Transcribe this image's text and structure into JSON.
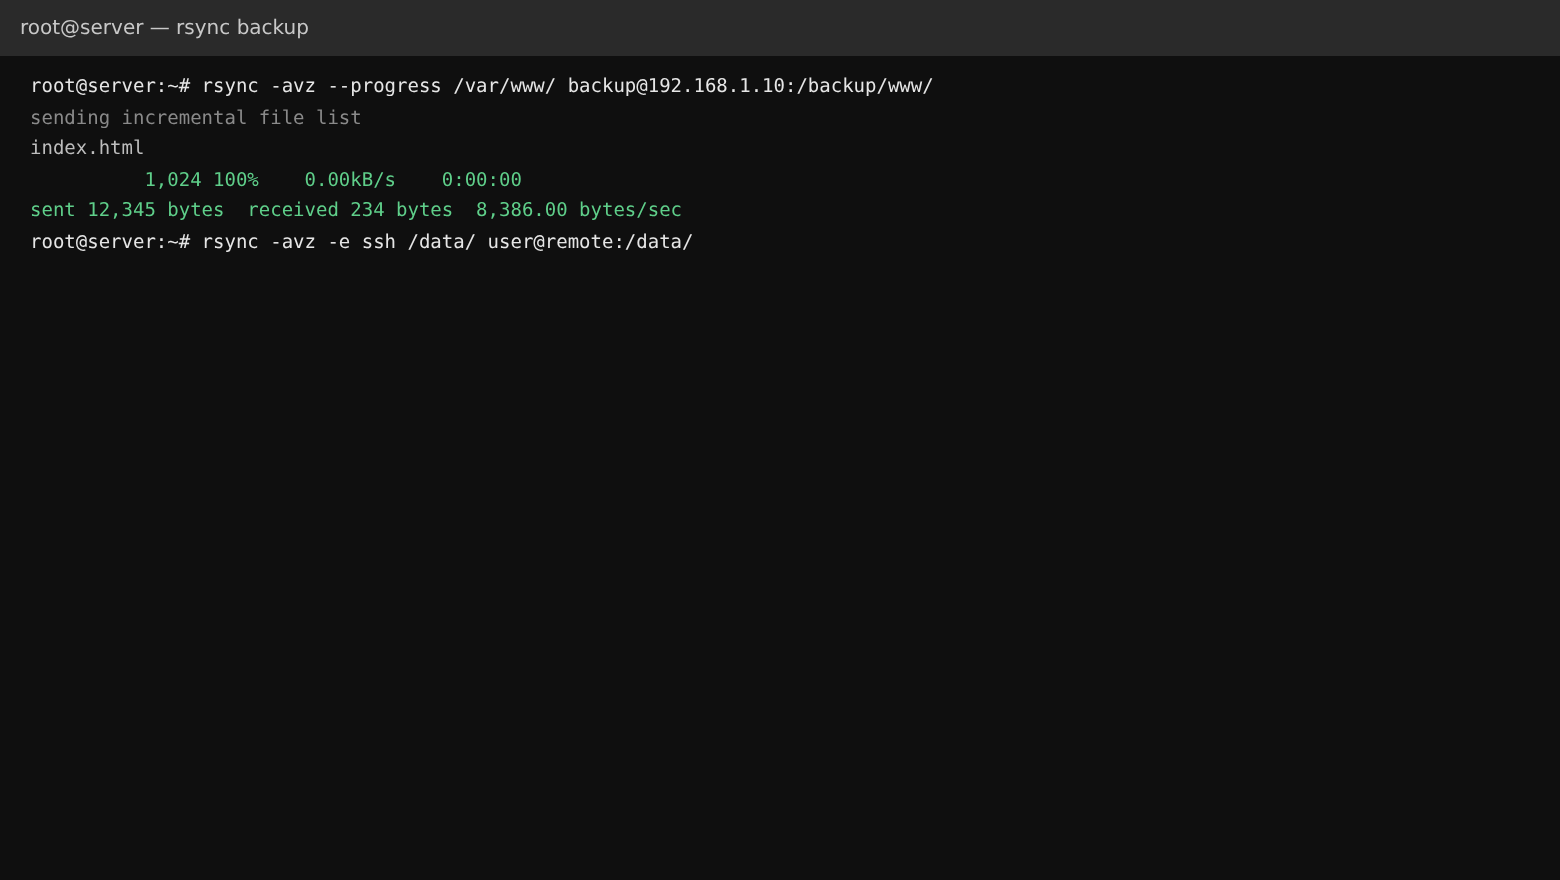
{
  "window": {
    "title": "root@server — rsync backup"
  },
  "terminal": {
    "lines": [
      {
        "kind": "command",
        "text": "root@server:~# rsync -avz --progress /var/www/ backup@192.168.1.10:/backup/www/"
      },
      {
        "kind": "info",
        "text": "sending incremental file list"
      },
      {
        "kind": "output",
        "text": "index.html"
      },
      {
        "kind": "success",
        "text": "          1,024 100%    0.00kB/s    0:00:00"
      },
      {
        "kind": "success",
        "text": "sent 12,345 bytes  received 234 bytes  8,386.00 bytes/sec"
      },
      {
        "kind": "command",
        "text": "root@server:~# rsync -avz -e ssh /data/ user@remote:/data/"
      }
    ]
  }
}
